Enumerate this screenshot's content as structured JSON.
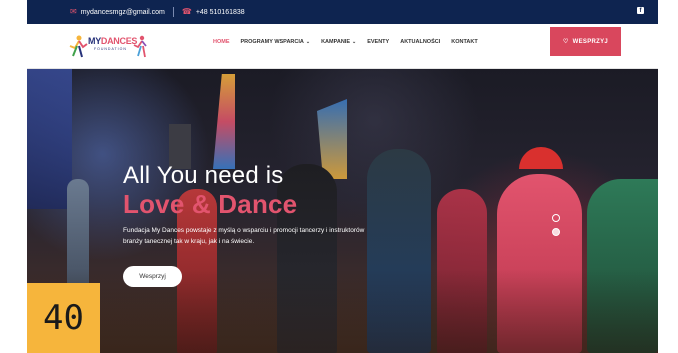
{
  "topbar": {
    "email": "mydancesmgz@gmail.com",
    "phone": "+48 510161838",
    "email_icon": "envelope-icon",
    "phone_icon": "phone-icon",
    "social_icon": "facebook-icon"
  },
  "logo": {
    "name_part1": "MY",
    "name_part2": "DANCES",
    "sub": "FOUNDATION"
  },
  "nav": {
    "items": [
      {
        "label": "HOME"
      },
      {
        "label": "PROGRAMY WSPARCIA"
      },
      {
        "label": "KAMPANIE"
      },
      {
        "label": "EVENTY"
      },
      {
        "label": "AKTUALNOŚCI"
      },
      {
        "label": "KONTAKT"
      }
    ],
    "active_index": 0
  },
  "donate": {
    "label": "WESPRZYJ",
    "icon": "heart-icon"
  },
  "hero": {
    "title_line1": "All You need is",
    "title_line2": "Love & Dance",
    "description": "Fundacja My Dances powstaje z myślą o wsparciu i promocji tancerzy i instruktorów branży tanecznej tak w kraju, jak i na świecie.",
    "button_label": "Wesprzyj",
    "slider_dots": 2,
    "active_dot": 1
  },
  "badge": {
    "value": "40"
  },
  "colors": {
    "navy": "#0e2450",
    "accent": "#e2546e",
    "donate_bg": "#d9475d",
    "badge_bg": "#f6b53c"
  }
}
